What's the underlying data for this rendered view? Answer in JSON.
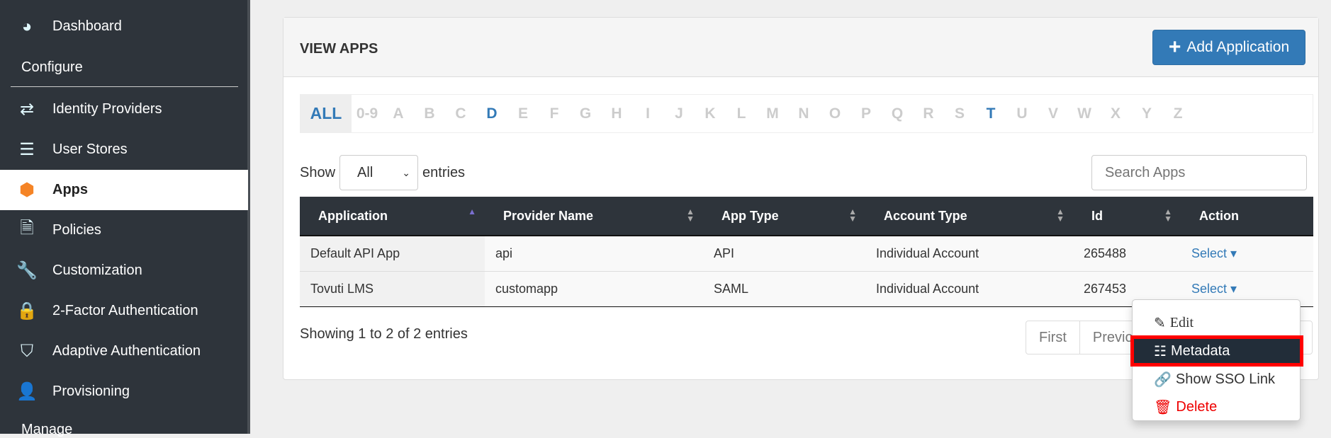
{
  "sidebar": {
    "items": [
      {
        "label": "Dashboard",
        "icon": "dashboard-icon"
      },
      {
        "label": "Identity Providers",
        "icon": "exchange-icon"
      },
      {
        "label": "User Stores",
        "icon": "database-icon"
      },
      {
        "label": "Apps",
        "icon": "cube-icon",
        "active": true
      },
      {
        "label": "Policies",
        "icon": "file-icon"
      },
      {
        "label": "Customization",
        "icon": "wrench-icon"
      },
      {
        "label": "2-Factor Authentication",
        "icon": "lock-icon"
      },
      {
        "label": "Adaptive Authentication",
        "icon": "shield-icon"
      },
      {
        "label": "Provisioning",
        "icon": "user-icon"
      }
    ],
    "section_configure": "Configure",
    "section_manage": "Manage"
  },
  "card": {
    "title": "VIEW APPS",
    "add_label": "Add Application"
  },
  "alphabet": [
    "ALL",
    "0-9",
    "A",
    "B",
    "C",
    "D",
    "E",
    "F",
    "G",
    "H",
    "I",
    "J",
    "K",
    "L",
    "M",
    "N",
    "O",
    "P",
    "Q",
    "R",
    "S",
    "T",
    "U",
    "V",
    "W",
    "X",
    "Y",
    "Z"
  ],
  "show": {
    "label": "Show",
    "value": "All",
    "suffix": "entries"
  },
  "search": {
    "placeholder": "Search Apps"
  },
  "table": {
    "headers": [
      "Application",
      "Provider Name",
      "App Type",
      "Account Type",
      "Id",
      "Action"
    ],
    "rows": [
      [
        "Default API App",
        "api",
        "API",
        "Individual Account",
        "265488",
        "Select"
      ],
      [
        "Tovuti LMS",
        "customapp",
        "SAML",
        "Individual Account",
        "267453",
        "Select"
      ]
    ]
  },
  "info": "Showing 1 to 2 of 2 entries",
  "pager": {
    "first": "First",
    "previous": "Previous"
  },
  "menu": {
    "edit": "Edit",
    "metadata": "Metadata",
    "sso": "Show SSO Link",
    "delete": "Delete"
  },
  "colors": {
    "accent": "#337ab7",
    "sidebar": "#2e343b",
    "apps_icon": "#f58426",
    "delete": "#e00000",
    "highlight": "#ff0000"
  }
}
